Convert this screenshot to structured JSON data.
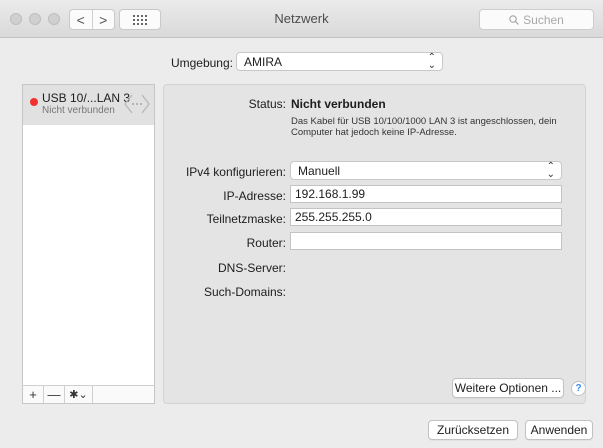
{
  "window": {
    "title": "Netzwerk"
  },
  "toolbar": {
    "back_glyph": "<",
    "forward_glyph": ">",
    "search_placeholder": "Suchen",
    "search_icon": "magnifier-icon",
    "grid_icon": "grid-icon"
  },
  "location": {
    "label": "Umgebung:",
    "value": "AMIRA"
  },
  "sidebar": {
    "items": [
      {
        "name": "USB 10/...LAN 3",
        "status": "Nicht verbunden",
        "status_color": "#f2312e",
        "icon": "ethernet-icon"
      }
    ],
    "add_glyph": "+",
    "remove_glyph": "—",
    "gear_glyph": "✱⌄"
  },
  "detail": {
    "status_label": "Status:",
    "status_value": "Nicht verbunden",
    "status_description": "Das Kabel für USB 10/100/1000 LAN 3 ist angeschlossen, dein Computer hat jedoch keine IP-Adresse.",
    "ipv4_label": "IPv4 konfigurieren:",
    "ipv4_value": "Manuell",
    "ip_label": "IP-Adresse:",
    "ip_value": "192.168.1.99",
    "mask_label": "Teilnetzmaske:",
    "mask_value": "255.255.255.0",
    "router_label": "Router:",
    "router_value": "",
    "dns_label": "DNS-Server:",
    "domains_label": "Such-Domains:",
    "advanced_button": "Weitere Optionen ...",
    "help_glyph": "?"
  },
  "footer": {
    "revert_button": "Zurücksetzen",
    "apply_button": "Anwenden"
  },
  "colors": {
    "accent_help": "#3b8af0",
    "disconnected": "#f2312e"
  }
}
